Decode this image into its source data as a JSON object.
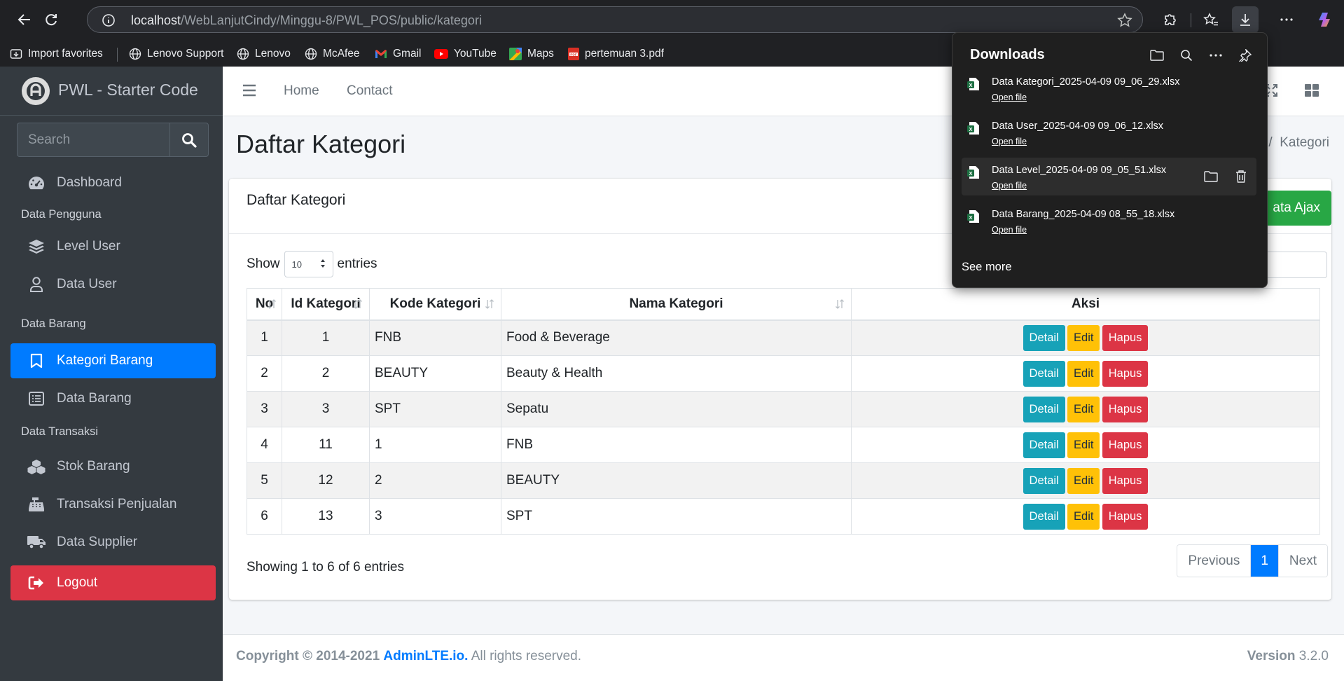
{
  "browser": {
    "url_host": "localhost",
    "url_path": "/WebLanjutCindy/Minggu-8/PWL_POS/public/kategori",
    "bookmarks": [
      {
        "label": "Import favorites",
        "icon": "import-icon"
      },
      {
        "label": "Lenovo Support",
        "icon": "globe-icon"
      },
      {
        "label": "Lenovo",
        "icon": "globe-icon"
      },
      {
        "label": "McAfee",
        "icon": "globe-icon"
      },
      {
        "label": "Gmail",
        "icon": "gmail-icon"
      },
      {
        "label": "YouTube",
        "icon": "youtube-icon"
      },
      {
        "label": "Maps",
        "icon": "maps-icon"
      },
      {
        "label": "pertemuan 3.pdf",
        "icon": "pdf-icon"
      }
    ]
  },
  "sidebar": {
    "brand": "PWL - Starter Code",
    "search_placeholder": "Search",
    "dashboard": "Dashboard",
    "header_pengguna": "Data Pengguna",
    "level_user": "Level User",
    "data_user": "Data User",
    "header_barang": "Data Barang",
    "kategori_barang": "Kategori Barang",
    "data_barang": "Data Barang",
    "header_transaksi": "Data Transaksi",
    "stok_barang": "Stok Barang",
    "transaksi_penjualan": "Transaksi Penjualan",
    "data_supplier": "Data Supplier",
    "logout": "Logout"
  },
  "topnav": {
    "home": "Home",
    "contact": "Contact"
  },
  "page": {
    "title": "Daftar Kategori",
    "breadcrumb_sep": "/",
    "breadcrumb_current": "Kategori"
  },
  "card": {
    "title": "Daftar Kategori",
    "ajax_button": "ata Ajax",
    "show_label": "Show",
    "length_value": "10",
    "entries_label": "entries",
    "info": "Showing 1 to 6 of 6 entries",
    "prev": "Previous",
    "page": "1",
    "next": "Next"
  },
  "table": {
    "headers": [
      "No",
      "Id Kategori",
      "Kode Kategori",
      "Nama Kategori",
      "Aksi"
    ],
    "rows": [
      [
        "1",
        "1",
        "FNB",
        "Food & Beverage"
      ],
      [
        "2",
        "2",
        "BEAUTY",
        "Beauty & Health"
      ],
      [
        "3",
        "3",
        "SPT",
        "Sepatu"
      ],
      [
        "4",
        "11",
        "1",
        "FNB"
      ],
      [
        "5",
        "12",
        "2",
        "BEAUTY"
      ],
      [
        "6",
        "13",
        "3",
        "SPT"
      ]
    ],
    "actions": {
      "detail": "Detail",
      "edit": "Edit",
      "hapus": "Hapus"
    }
  },
  "footer": {
    "copyright": "Copyright © 2014-2021",
    "brand_link": "AdminLTE.io.",
    "rights": "All rights reserved.",
    "version_label": "Version",
    "version": "3.2.0"
  },
  "downloads": {
    "title": "Downloads",
    "open_label": "Open file",
    "see_more": "See more",
    "items": [
      "Data Kategori_2025-04-09 09_06_29.xlsx",
      "Data User_2025-04-09 09_06_12.xlsx",
      "Data Level_2025-04-09 09_05_51.xlsx",
      "Data Barang_2025-04-09 08_55_18.xlsx"
    ]
  },
  "colors": {
    "primary": "#007bff",
    "success": "#28a745",
    "info": "#17a2b8",
    "warning": "#ffc107",
    "danger": "#dc3545",
    "sidebar": "#343a40"
  }
}
